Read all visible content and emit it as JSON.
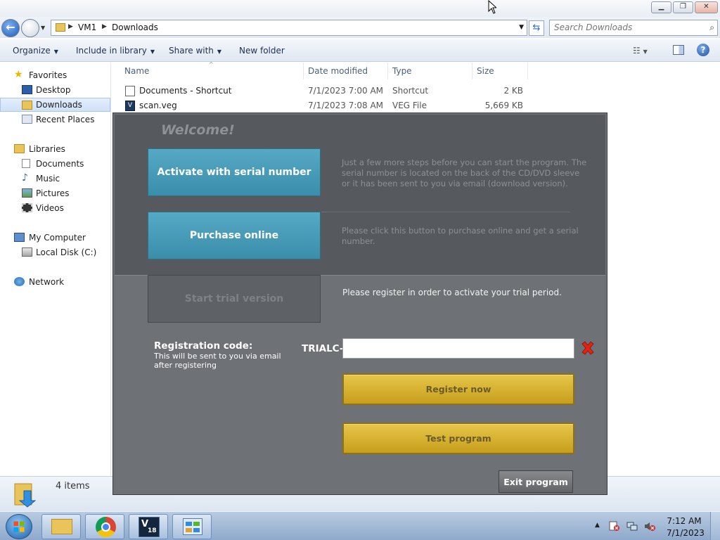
{
  "window": {
    "breadcrumb": [
      "VM1",
      "Downloads"
    ],
    "search_placeholder": "Search Downloads"
  },
  "toolbar": {
    "organize": "Organize",
    "include_in_library": "Include in library",
    "share_with": "Share with",
    "new_folder": "New folder"
  },
  "nav": {
    "favorites": "Favorites",
    "desktop": "Desktop",
    "downloads": "Downloads",
    "recent_places": "Recent Places",
    "libraries": "Libraries",
    "documents": "Documents",
    "music": "Music",
    "pictures": "Pictures",
    "videos": "Videos",
    "my_computer": "My Computer",
    "local_disk": "Local Disk (C:)",
    "network": "Network"
  },
  "columns": {
    "name": "Name",
    "date_modified": "Date modified",
    "type": "Type",
    "size": "Size"
  },
  "files": [
    {
      "name": "Documents - Shortcut",
      "date": "7/1/2023 7:00 AM",
      "type": "Shortcut",
      "size": "2 KB",
      "icon": "shortcut-icon"
    },
    {
      "name": "scan.veg",
      "date": "7/1/2023 7:08 AM",
      "type": "VEG File",
      "size": "5,669 KB",
      "icon": "vegas-file-icon"
    }
  ],
  "status": {
    "item_count": "4 items"
  },
  "dialog": {
    "welcome": "Welcome!",
    "activate_label": "Activate with serial number",
    "activate_desc": "Just a few more steps before you can start the program. The serial number is located on the back of the CD/DVD sleeve or it has been sent to you via email (download version).",
    "purchase_label": "Purchase online",
    "purchase_desc": "Please click this button to purchase online and get a serial number.",
    "trial_label": "Start trial version",
    "trial_message": "Please register in order to activate your trial period.",
    "registration_label": "Registration code:",
    "registration_hint": "This will be sent to you via email after registering",
    "code_prefix": "TRIALC-",
    "code_value": "",
    "register_label": "Register now",
    "test_label": "Test program",
    "exit_label": "Exit program"
  },
  "taskbar": {
    "time": "7:12 AM",
    "date": "7/1/2023",
    "vegas_version": "18"
  },
  "colors": {
    "teal_button": "#3f93b0",
    "gold_button": "#d6b02e",
    "dialog_dark": "#56595e",
    "dialog_mid": "#6e7176"
  }
}
